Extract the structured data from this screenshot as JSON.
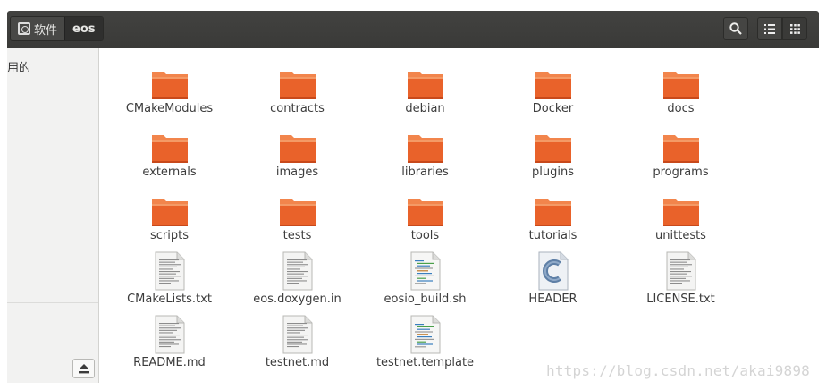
{
  "header": {
    "breadcrumbs": [
      {
        "label": "软件",
        "icon": "home-drive-icon"
      },
      {
        "label": "eos"
      }
    ],
    "buttons": [
      "search-icon",
      "list-view-icon",
      "grid-view-icon"
    ]
  },
  "sidebar": {
    "visible_label": "用的",
    "eject_icon": "eject-icon"
  },
  "files": [
    {
      "name": "CMakeModules",
      "type": "folder"
    },
    {
      "name": "contracts",
      "type": "folder"
    },
    {
      "name": "debian",
      "type": "folder"
    },
    {
      "name": "Docker",
      "type": "folder"
    },
    {
      "name": "docs",
      "type": "folder"
    },
    {
      "name": "externals",
      "type": "folder"
    },
    {
      "name": "images",
      "type": "folder"
    },
    {
      "name": "libraries",
      "type": "folder"
    },
    {
      "name": "plugins",
      "type": "folder"
    },
    {
      "name": "programs",
      "type": "folder"
    },
    {
      "name": "scripts",
      "type": "folder"
    },
    {
      "name": "tests",
      "type": "folder"
    },
    {
      "name": "tools",
      "type": "folder"
    },
    {
      "name": "tutorials",
      "type": "folder"
    },
    {
      "name": "unittests",
      "type": "folder"
    },
    {
      "name": "CMakeLists.txt",
      "type": "text"
    },
    {
      "name": "eos.doxygen.in",
      "type": "text"
    },
    {
      "name": "eosio_build.sh",
      "type": "script"
    },
    {
      "name": "HEADER",
      "type": "c-source"
    },
    {
      "name": "LICENSE.txt",
      "type": "text"
    },
    {
      "name": "README.md",
      "type": "text"
    },
    {
      "name": "testnet.md",
      "type": "text"
    },
    {
      "name": "testnet.template",
      "type": "script"
    }
  ],
  "watermark": "https://blog.csdn.net/akai9898",
  "colors": {
    "folder_front": "#e9622a",
    "folder_back": "#f2854c",
    "header_bg": "#3c3c3a",
    "accent_c": "#5e7fa6"
  }
}
